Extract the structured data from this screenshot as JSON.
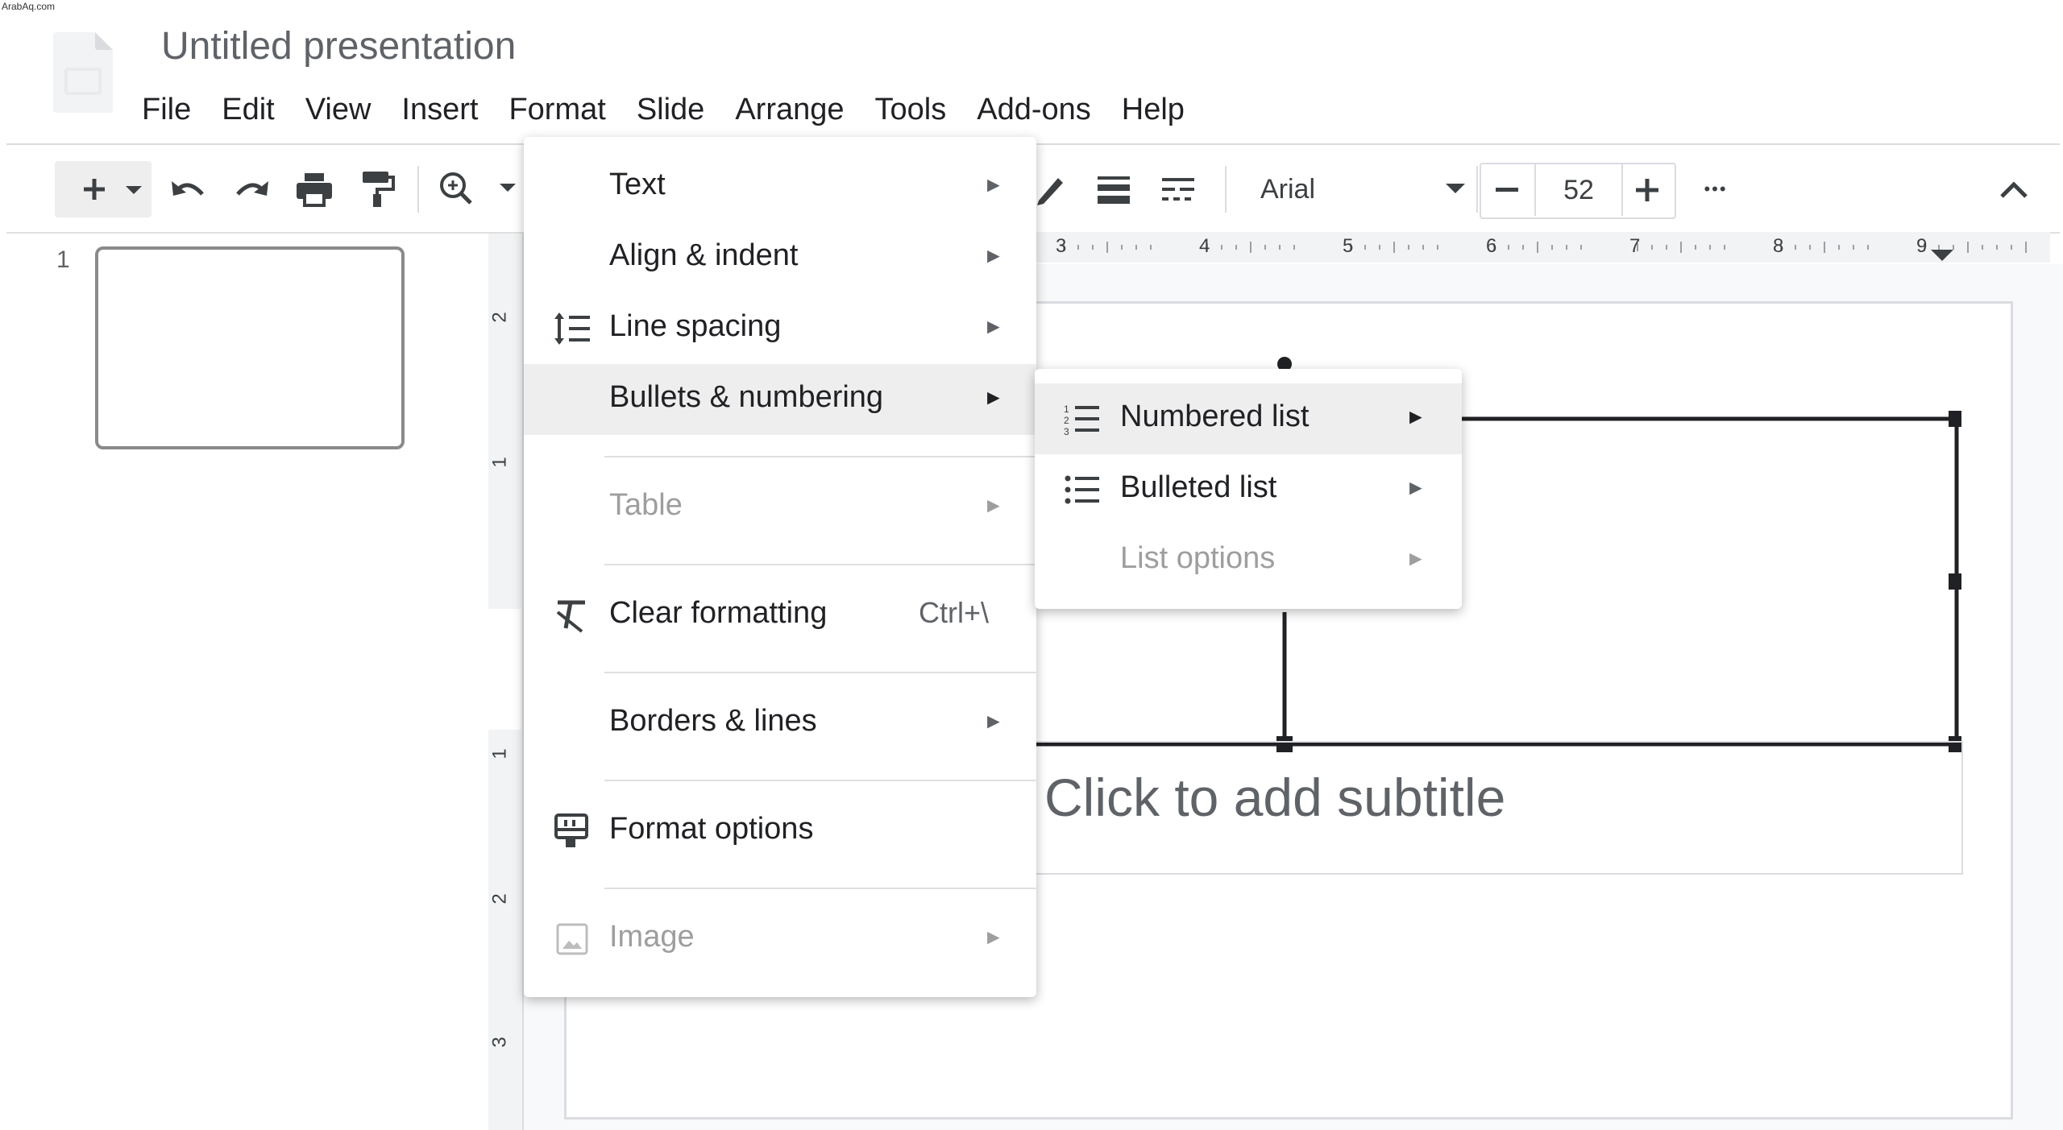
{
  "watermark": "ArabAq.com",
  "app": {
    "title": "Untitled presentation"
  },
  "menubar": [
    "File",
    "Edit",
    "View",
    "Insert",
    "Format",
    "Slide",
    "Arrange",
    "Tools",
    "Add-ons",
    "Help"
  ],
  "toolbar": {
    "font": "Arial",
    "font_size": "52"
  },
  "ruler": {
    "horizontal": [
      "3",
      "4",
      "5",
      "6",
      "7",
      "8",
      "9"
    ],
    "vertical": [
      "2",
      "1",
      "1",
      "2",
      "3"
    ]
  },
  "filmstrip": {
    "slide_number": "1"
  },
  "slide": {
    "subtitle_placeholder": "Click to add subtitle"
  },
  "format_menu": {
    "items": [
      {
        "label": "Text",
        "has_submenu": true
      },
      {
        "label": "Align & indent",
        "has_submenu": true
      },
      {
        "label": "Line spacing",
        "has_submenu": true,
        "icon": "line-spacing-icon"
      },
      {
        "label": "Bullets & numbering",
        "has_submenu": true,
        "highlighted": true
      },
      {
        "label": "Table",
        "has_submenu": true,
        "disabled": true
      },
      {
        "label": "Clear formatting",
        "shortcut": "Ctrl+\\",
        "icon": "clear-formatting-icon"
      },
      {
        "label": "Borders & lines",
        "has_submenu": true
      },
      {
        "label": "Format options",
        "icon": "format-options-icon"
      },
      {
        "label": "Image",
        "has_submenu": true,
        "disabled": true,
        "icon": "image-icon"
      }
    ]
  },
  "bullets_submenu": {
    "items": [
      {
        "label": "Numbered list",
        "highlighted": true,
        "icon": "numbered-list-icon"
      },
      {
        "label": "Bulleted list",
        "icon": "bulleted-list-icon"
      },
      {
        "label": "List options",
        "disabled": true
      }
    ]
  },
  "glyphs": {
    "submenu_arrow": "►",
    "more": "•••"
  }
}
